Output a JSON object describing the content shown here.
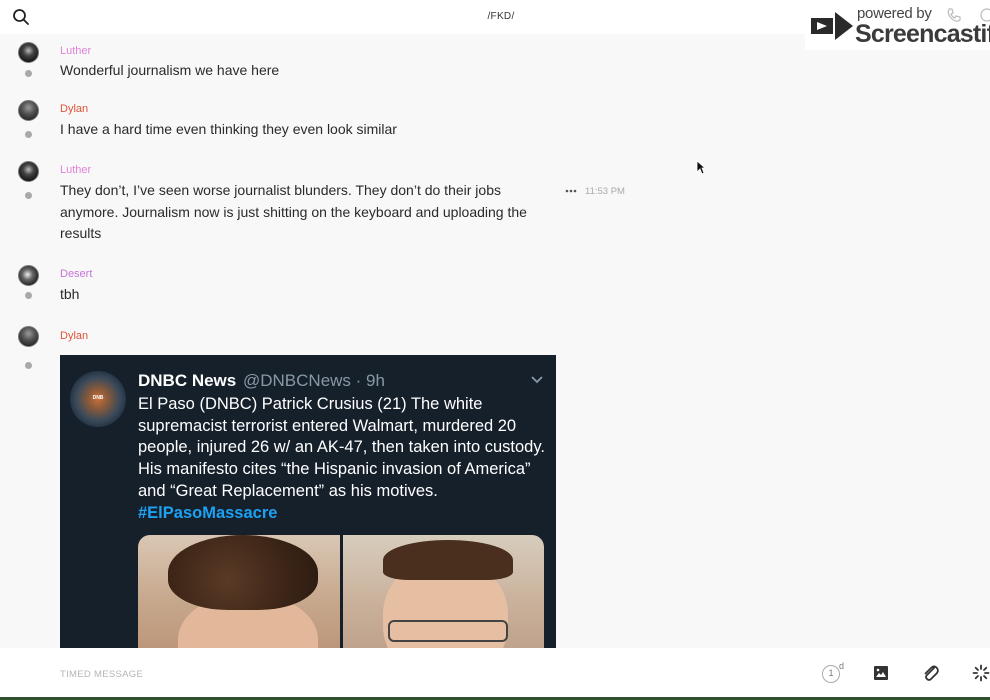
{
  "header": {
    "title": "/FKD/",
    "search_icon": "search-icon",
    "phone_icon": "phone-icon",
    "info_icon": "info-icon"
  },
  "watermark": {
    "powered_by": "powered by",
    "brand": "Screencastify"
  },
  "messages": [
    {
      "sender": "Luther",
      "sender_color": "#e083d8",
      "text": "Wonderful journalism we have here"
    },
    {
      "sender": "Dylan",
      "sender_color": "#e0533a",
      "text": "I have a hard time even thinking they even look similar"
    },
    {
      "sender": "Luther",
      "sender_color": "#e083d8",
      "text": "They don’t, I’ve seen worse journalist blunders. They don’t do their jobs anymore. Journalism now is just shitting on the keyboard and uploading the results",
      "timestamp": "11:53 PM"
    },
    {
      "sender": "Desert",
      "sender_color": "#c574d4",
      "text": "tbh"
    },
    {
      "sender": "Dylan",
      "sender_color": "#e0533a"
    }
  ],
  "tweet": {
    "avatar_text": "DNB",
    "name": "DNBC News",
    "handle_time": "@DNBCNews · 9h",
    "body": "El Paso (DNBC) Patrick Crusius (21) The white supremacist terrorist entered Walmart, murdered 20 people, injured 26 w/ an AK-47, then taken into custody. His manifesto cites “the Hispanic invasion of America” and “Great Replacement” as his motives.",
    "hashtag": "#ElPasoMassacre"
  },
  "composer": {
    "placeholder": "TIMED MESSAGE",
    "timer_value": "1",
    "timer_unit": "d"
  },
  "colors": {
    "background": "#f8f8f8",
    "tweet_background": "#15202b",
    "hashtag": "#1da1f2"
  }
}
